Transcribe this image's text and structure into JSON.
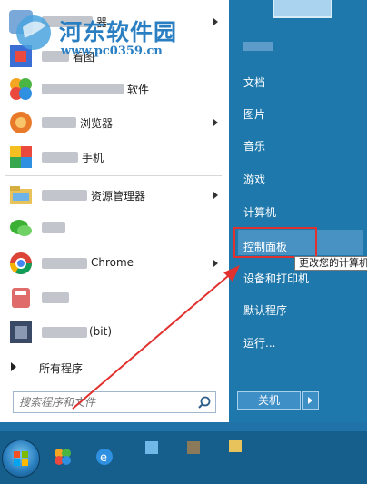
{
  "watermark": {
    "title": "河东软件园",
    "url": "www.pc0359.cn"
  },
  "programs": [
    {
      "label": "器",
      "has_arrow": true
    },
    {
      "label": "看图",
      "has_arrow": false
    },
    {
      "label": "软件",
      "has_arrow": false
    },
    {
      "label": "浏览器",
      "has_arrow": true
    },
    {
      "label": "手机",
      "has_arrow": false
    },
    {
      "label": "资源管理器",
      "has_arrow": true
    },
    {
      "label": "",
      "has_arrow": false
    },
    {
      "label": "Chrome",
      "has_arrow": true
    },
    {
      "label": "",
      "has_arrow": false
    },
    {
      "label": "(bit)",
      "has_arrow": false
    }
  ],
  "all_programs_label": "所有程序",
  "search": {
    "placeholder": "搜索程序和文件"
  },
  "right_menu": {
    "items": [
      "文档",
      "图片",
      "音乐",
      "游戏",
      "计算机",
      "控制面板",
      "设备和打印机",
      "默认程序",
      "运行..."
    ]
  },
  "tooltip": "更改您的计算机",
  "shutdown_label": "关机",
  "colors": {
    "highlight_border": "#e0312f",
    "arrow": "#e0312f",
    "panel": "#1e78ac"
  }
}
